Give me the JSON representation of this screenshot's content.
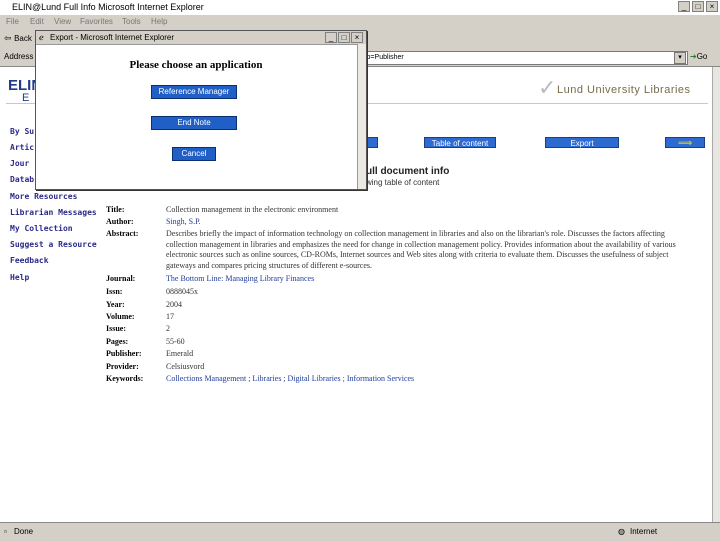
{
  "window": {
    "title": "ELIN@Lund  Full Info  Microsoft Internet Explorer",
    "buttons": [
      "_",
      "□",
      "×"
    ]
  },
  "menubar": [
    "File",
    "Edit",
    "View",
    "Favorites",
    "Tools",
    "Help"
  ],
  "toolbar": {
    "back_label": "Back"
  },
  "addressbar": {
    "label": "Address",
    "url_tail": "ch=Zbob=Publisher",
    "go_label": "Go"
  },
  "header": {
    "logo_text": "ELIN",
    "logo_sub": "E",
    "library_name": "Lund University Libraries"
  },
  "sidebar": {
    "items": [
      {
        "label": "By Su"
      },
      {
        "label": "Artic"
      },
      {
        "label": "Jour"
      },
      {
        "label": "Datab"
      },
      {
        "label": "More Resources"
      },
      {
        "label": "Librarian Messages"
      },
      {
        "label": "My Collection"
      },
      {
        "label": "Suggest a Resource"
      },
      {
        "label": "Feedback"
      },
      {
        "label": "Help"
      }
    ]
  },
  "actions": {
    "toc_label": "Table of content",
    "export_label": "Export",
    "next_arrow": "⟹"
  },
  "document": {
    "heading": "ull document info",
    "subheading": "wing table of content",
    "fields": [
      {
        "label": "Title:",
        "value": "Collection management in the electronic environment"
      },
      {
        "label": "Author:",
        "value": "Singh, S.P."
      },
      {
        "label": "Abstract:",
        "value": "Describes briefly the impact of information technology on collection management in libraries and also on the librarian's role. Discusses the factors affecting collection management in libraries and emphasizes the need for change in collection management policy. Provides information about the availability of various electronic sources such as online sources, CD-ROMs, Internet sources and Web sites along with criteria to evaluate them. Discusses the usefulness of subject gateways and compares pricing structures of different e-sources."
      },
      {
        "label": "Journal:",
        "value": "The Bottom Line: Managing Library Finances"
      },
      {
        "label": "Issn:",
        "value": "0888045x"
      },
      {
        "label": "Year:",
        "value": "2004"
      },
      {
        "label": "Volume:",
        "value": "17"
      },
      {
        "label": "Issue:",
        "value": "2"
      },
      {
        "label": "Pages:",
        "value": "55-60"
      },
      {
        "label": "Publisher:",
        "value": "Emerald"
      },
      {
        "label": "Provider:",
        "value": "Celsiusvord"
      },
      {
        "label": "Keywords:",
        "value": "Collections Management ; Libraries ; Digital Libraries ; Information Services"
      }
    ]
  },
  "dialog": {
    "title": "Export - Microsoft Internet Explorer",
    "heading": "Please choose an application",
    "buttons": {
      "reference_manager": "Reference Manager",
      "endnote": "End Note",
      "cancel": "Cancel"
    }
  },
  "statusbar": {
    "left": "Done",
    "zone": "Internet"
  }
}
